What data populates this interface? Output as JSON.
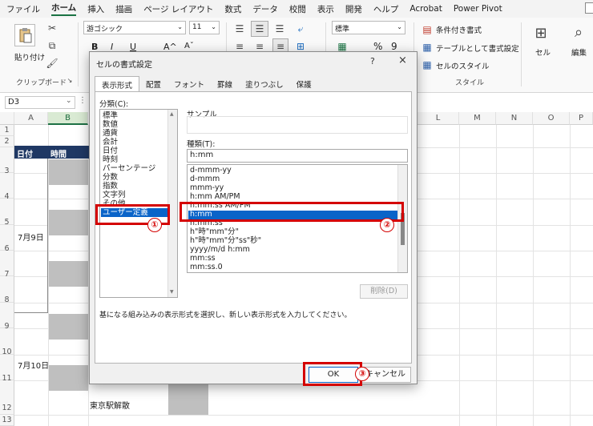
{
  "ribbon": {
    "tabs": [
      "ファイル",
      "ホーム",
      "挿入",
      "描画",
      "ページ レイアウト",
      "数式",
      "データ",
      "校閲",
      "表示",
      "開発",
      "ヘルプ",
      "Acrobat",
      "Power Pivot"
    ],
    "active_tab": "ホーム",
    "clipboard": {
      "paste_label": "貼り付け",
      "group_label": "クリップボード"
    },
    "font": {
      "name": "游ゴシック",
      "size": "11",
      "bold": "B",
      "italic": "I",
      "underline": "U",
      "grow": "A^",
      "shrink": "Aˇ"
    },
    "number": {
      "format": "標準",
      "percent": "%",
      "comma": "9"
    },
    "styles": {
      "conditional": "条件付き書式",
      "table": "テーブルとして書式設定",
      "cell_styles": "セルのスタイル",
      "group_label": "スタイル"
    },
    "cells_label": "セル",
    "edit_label": "編集"
  },
  "formula_bar": {
    "name_box": "D3"
  },
  "sheet": {
    "columns": [
      "A",
      "B",
      "L",
      "M",
      "N",
      "O",
      "P"
    ],
    "rows": [
      "1",
      "2",
      "3",
      "4",
      "5",
      "6",
      "7",
      "8",
      "9",
      "10",
      "11",
      "12",
      "13"
    ],
    "headers": {
      "date": "日付",
      "time": "時間"
    },
    "cells": {
      "date1": "7月9日",
      "date2": "7月10日",
      "row12": "東京駅解散"
    }
  },
  "dialog": {
    "title": "セルの書式設定",
    "help": "?",
    "close": "×",
    "tabs": [
      "表示形式",
      "配置",
      "フォント",
      "罫線",
      "塗りつぶし",
      "保護"
    ],
    "active_tab": "表示形式",
    "category_label": "分類(C):",
    "categories": [
      "標準",
      "数値",
      "通貨",
      "会計",
      "日付",
      "時刻",
      "パーセンテージ",
      "分数",
      "指数",
      "文字列",
      "その他",
      "ユーザー定義"
    ],
    "selected_category": "ユーザー定義",
    "sample_label": "サンプル",
    "type_label": "種類(T):",
    "type_value": "h:mm",
    "formats": [
      "d-mmm-yy",
      "d-mmm",
      "mmm-yy",
      "h:mm AM/PM",
      "h:mm:ss AM/PM",
      "h:mm",
      "h:mm:ss",
      "h\"時\"mm\"分\"",
      "h\"時\"mm\"分\"ss\"秒\"",
      "yyyy/m/d h:mm",
      "mm:ss",
      "mm:ss.0"
    ],
    "selected_format": "h:mm",
    "delete_button": "削除(D)",
    "description": "基になる組み込みの表示形式を選択し、新しい表示形式を入力してください。",
    "ok_button": "OK",
    "cancel_button": "キャンセル"
  },
  "annotations": [
    "①",
    "②",
    "③"
  ],
  "colors": {
    "annotation_red": "#d40000",
    "selection_blue": "#0a64c8",
    "header_navy": "#1f3864",
    "excel_green": "#1e7145"
  }
}
